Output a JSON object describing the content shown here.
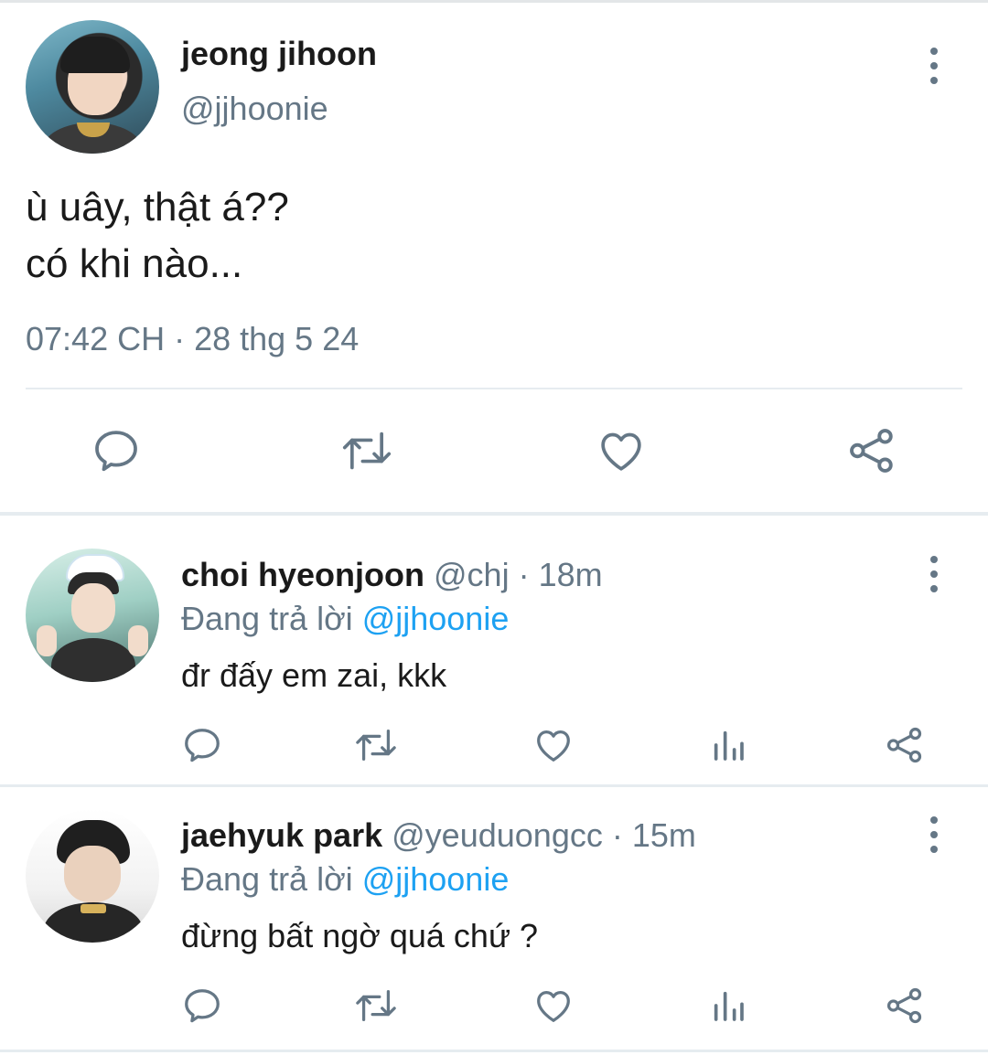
{
  "main_tweet": {
    "display_name": "jeong jihoon",
    "handle": "@jjhoonie",
    "text_lines": [
      "ù uây, thật á??",
      "có khi nào..."
    ],
    "timestamp": "07:42 CH · 28 thg 5 24",
    "actions": [
      "reply-icon",
      "retweet-icon",
      "like-icon",
      "share-icon"
    ]
  },
  "replies": [
    {
      "display_name": "choi hyeonjoon",
      "handle": "@chj",
      "time": "· 18m",
      "replying_prefix": "Đang trả lời",
      "replying_to": "@jjhoonie",
      "text": "đr đấy em zai, kkk",
      "actions": [
        "reply-icon",
        "retweet-icon",
        "like-icon",
        "analytics-icon",
        "share-icon"
      ]
    },
    {
      "display_name": "jaehyuk park",
      "handle": "@yeuduongcc",
      "time": "· 15m",
      "replying_prefix": "Đang trả lời",
      "replying_to": "@jjhoonie",
      "text": "đừng bất ngờ quá chứ ?",
      "actions": [
        "reply-icon",
        "retweet-icon",
        "like-icon",
        "analytics-icon",
        "share-icon"
      ]
    }
  ],
  "colors": {
    "text": "#1a1a1a",
    "muted": "#657786",
    "mention": "#1da1f2",
    "divider": "#e6ecf0"
  }
}
